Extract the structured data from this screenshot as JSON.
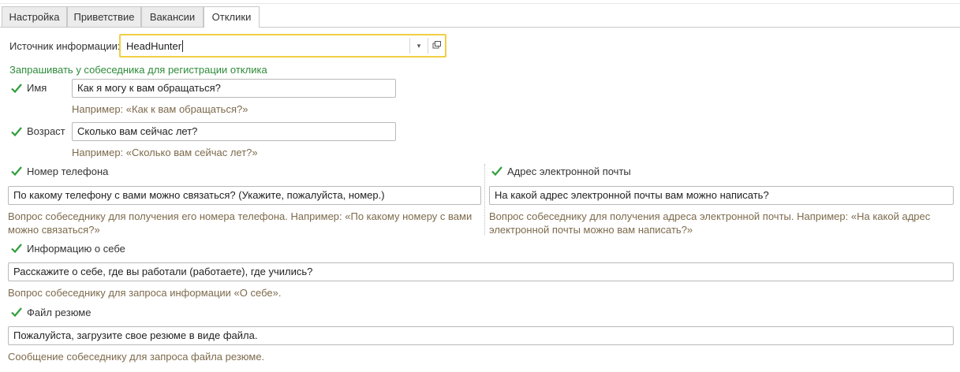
{
  "tabs": [
    "Настройка",
    "Приветствие",
    "Вакансии",
    "Отклики"
  ],
  "active_tab": "Отклики",
  "source": {
    "label": "Источник информации:",
    "value": "HeadHunter"
  },
  "ask_header": "Запрашивать у собеседника для регистрации отклика",
  "name": {
    "label": "Имя",
    "checked": true,
    "value": "Как я могу к вам обращаться?",
    "hint": "Например: «Как к вам обращаться?»"
  },
  "age": {
    "label": "Возраст",
    "checked": true,
    "value": "Сколько вам сейчас лет?",
    "hint": "Например: «Сколько вам сейчас лет?»"
  },
  "phone": {
    "label": "Номер телефона",
    "checked": true,
    "value": "По какому телефону с вами можно связаться? (Укажите, пожалуйста, номер.)",
    "hint": "Вопрос собеседнику для получения его номера телефона. Например: «По какому номеру с вами можно связаться?»"
  },
  "email": {
    "label": "Адрес электронной почты",
    "checked": true,
    "value": "На какой адрес электронной почты вам можно написать?",
    "hint": "Вопрос собеседнику для получения адреса электронной почты. Например: «На какой адрес электронной почты можно вам написать?»"
  },
  "about": {
    "label": "Информацию о себе",
    "checked": true,
    "value": "Расскажите о себе, где вы работали (работаете), где учились?",
    "hint": "Вопрос собеседнику для запроса информации «О себе»."
  },
  "resume": {
    "label": "Файл резюме",
    "checked": true,
    "value": "Пожалуйста, загрузите свое резюме в виде файла.",
    "hint": "Сообщение собеседнику для запроса файла резюме."
  },
  "colors": {
    "check": "#2f9e3c",
    "hint": "#7d6a4c",
    "header_green": "#2e8b3a",
    "focus_border": "#f2cf45"
  },
  "icons": {
    "check": "checkmark-icon",
    "dropdown": "chevron-down-icon",
    "open": "open-window-icon"
  }
}
